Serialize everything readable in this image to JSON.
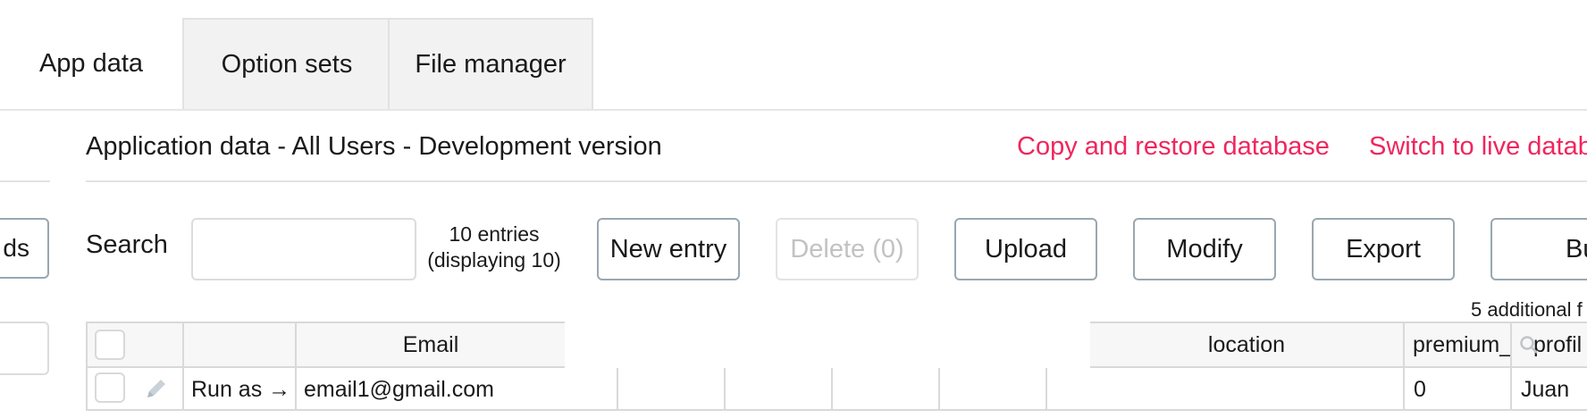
{
  "tabs": [
    {
      "label": "App data"
    },
    {
      "label": "Option sets"
    },
    {
      "label": "File manager"
    }
  ],
  "sidebar": {
    "button_label": "ds"
  },
  "header": {
    "title": "Application data - All Users - Development version",
    "copy_restore_link": "Copy and restore database",
    "switch_live_link": "Switch to live datab"
  },
  "toolbar": {
    "search_label": "Search",
    "search_value": "",
    "entries_line1": "10 entries",
    "entries_line2": "(displaying 10)",
    "new_entry": "New entry",
    "delete": "Delete (0)",
    "upload": "Upload",
    "modify": "Modify",
    "export": "Export",
    "bulk": "Bulk"
  },
  "additional_fields": "5 additional f",
  "table": {
    "columns": [
      "Email",
      "location",
      "premium_",
      "profil"
    ],
    "rows": [
      {
        "run_as": "Run as →",
        "email": "email1@gmail.com",
        "premium": "0",
        "profile": "Juan"
      }
    ]
  },
  "colors": {
    "accent_link": "#f0265d",
    "button_border": "#9aa7b0"
  }
}
